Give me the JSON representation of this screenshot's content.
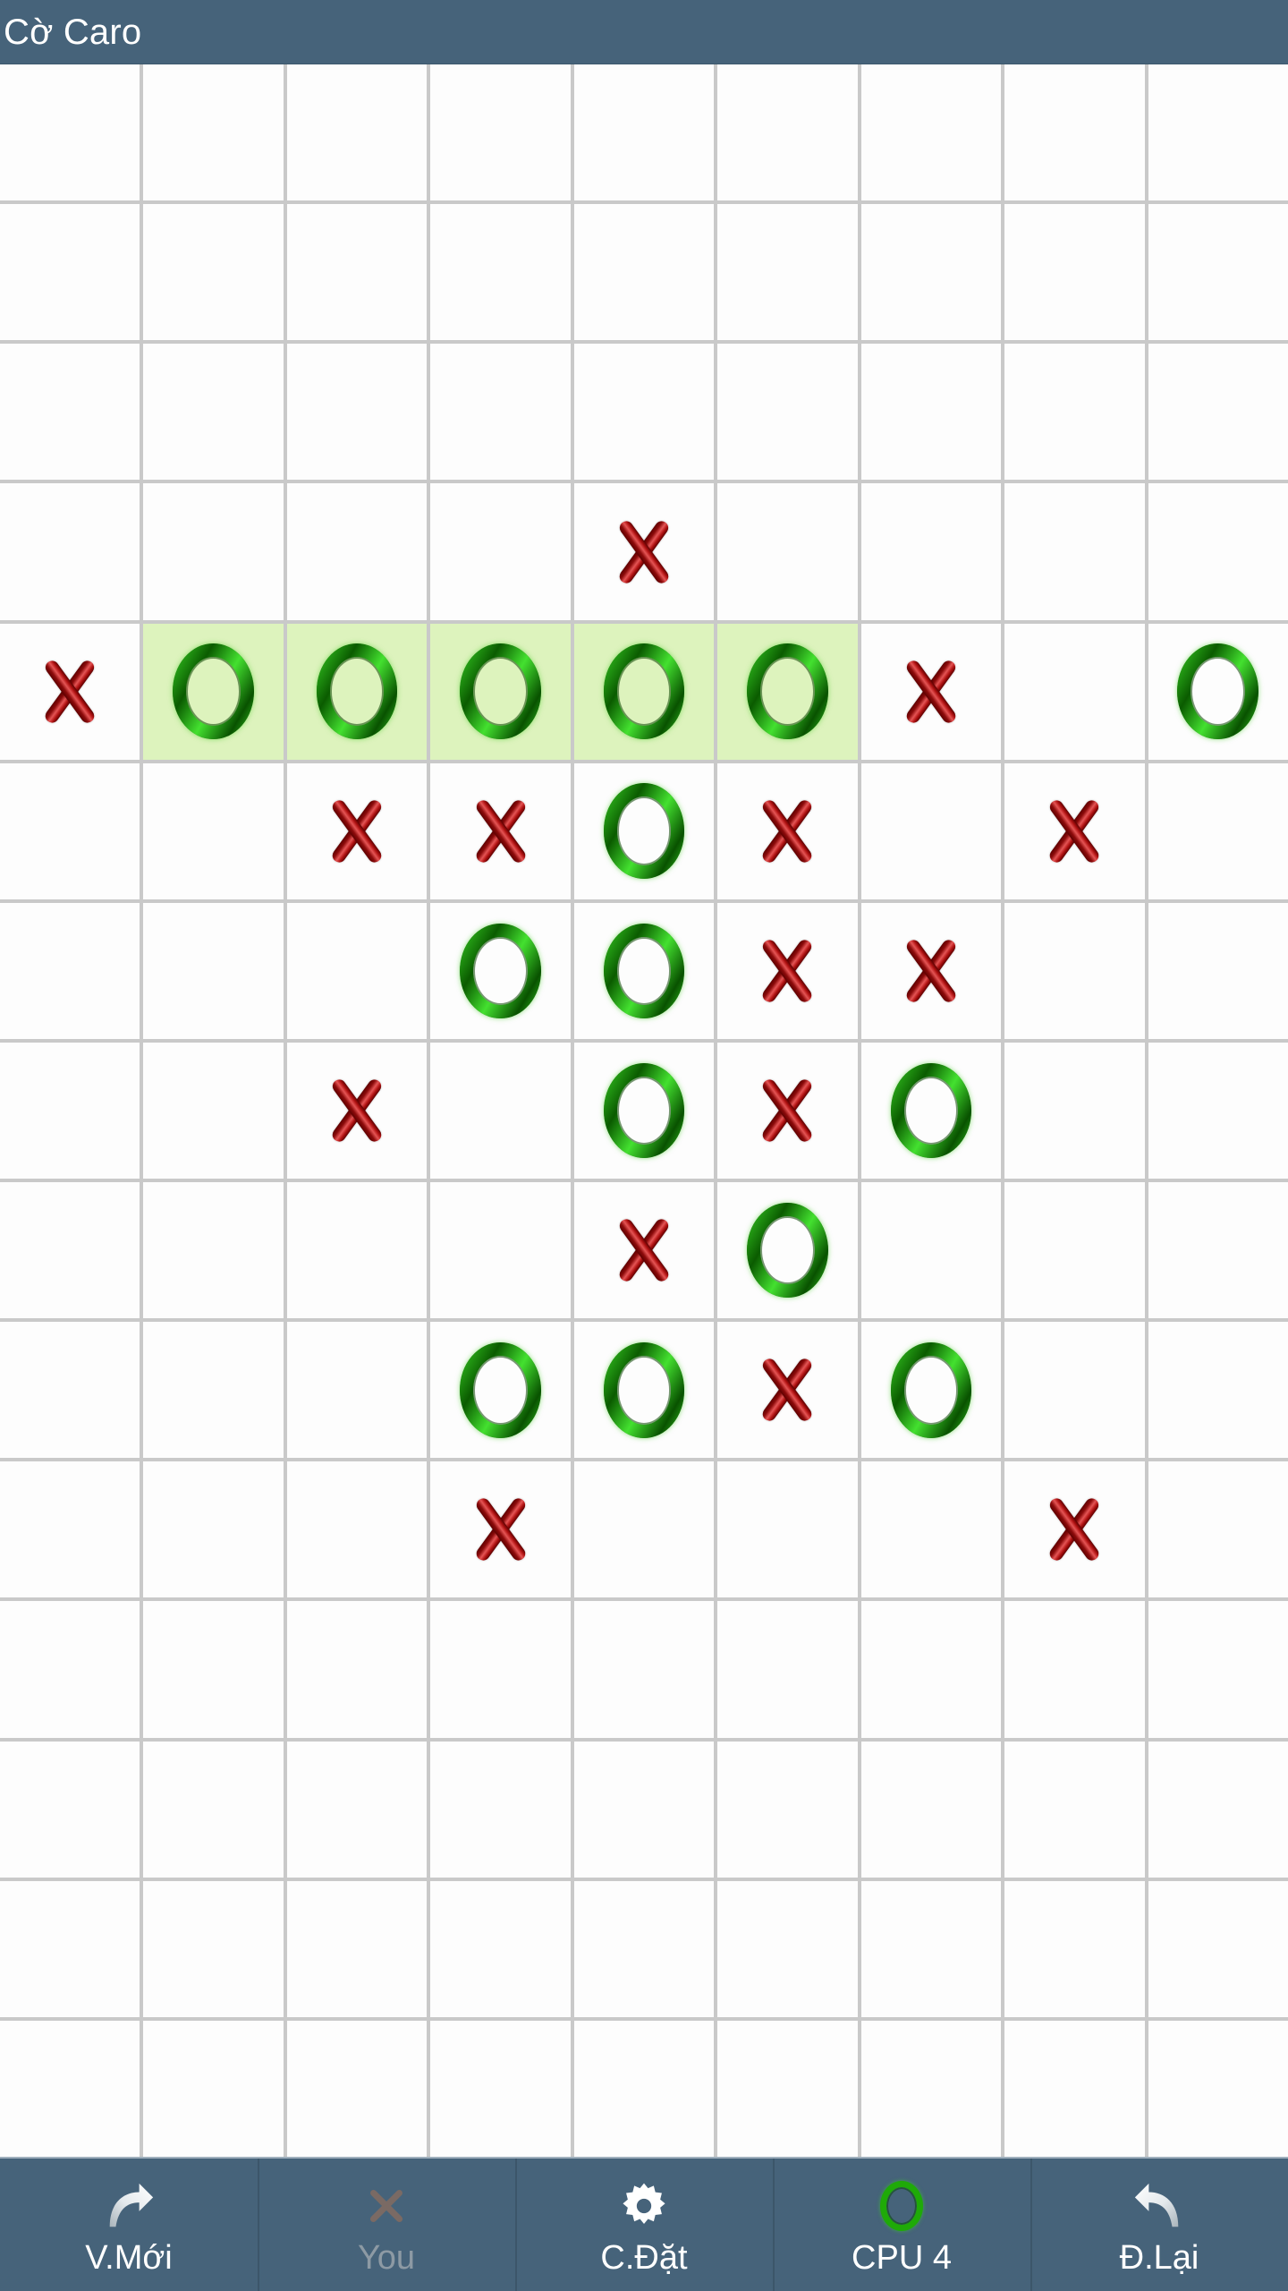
{
  "header": {
    "title": "Cờ Caro",
    "bg_color": "#46637a",
    "text_color": "#ffffff"
  },
  "board": {
    "columns": 9,
    "rows": 15,
    "grid_line_color": "#c9c9c9",
    "cell_color": "#fdfdfd",
    "highlight_color": "#ddf3bd",
    "x_color": "#8d0b0b",
    "o_color": "#1f7a0a",
    "legend": {
      "x": "X",
      "o": "O",
      "empty": ""
    },
    "cells": [
      [
        "",
        "",
        "",
        "",
        "",
        "",
        "",
        "",
        ""
      ],
      [
        "",
        "",
        "",
        "",
        "",
        "",
        "",
        "",
        ""
      ],
      [
        "",
        "",
        "",
        "",
        "",
        "",
        "",
        "",
        ""
      ],
      [
        "",
        "",
        "",
        "",
        "X",
        "",
        "",
        "",
        ""
      ],
      [
        "X",
        "O",
        "O",
        "O",
        "O",
        "O",
        "X",
        "",
        "O"
      ],
      [
        "",
        "",
        "X",
        "X",
        "O",
        "X",
        "",
        "X",
        ""
      ],
      [
        "",
        "",
        "",
        "O",
        "O",
        "X",
        "X",
        "",
        ""
      ],
      [
        "",
        "",
        "X",
        "",
        "O",
        "X",
        "O",
        "",
        ""
      ],
      [
        "",
        "",
        "",
        "",
        "X",
        "O",
        "",
        "",
        ""
      ],
      [
        "",
        "",
        "",
        "O",
        "O",
        "X",
        "O",
        "",
        ""
      ],
      [
        "",
        "",
        "",
        "X",
        "",
        "",
        "",
        "X",
        ""
      ],
      [
        "",
        "",
        "",
        "",
        "",
        "",
        "",
        "",
        ""
      ],
      [
        "",
        "",
        "",
        "",
        "",
        "",
        "",
        "",
        ""
      ],
      [
        "",
        "",
        "",
        "",
        "",
        "",
        "",
        "",
        ""
      ],
      [
        "",
        "",
        "",
        "",
        "",
        "",
        "",
        "",
        ""
      ]
    ],
    "highlighted": [
      [
        4,
        1
      ],
      [
        4,
        2
      ],
      [
        4,
        3
      ],
      [
        4,
        4
      ],
      [
        4,
        5
      ]
    ]
  },
  "toolbar": {
    "bg_color": "#46637a",
    "items": [
      {
        "label": "V.Mới",
        "icon": "redo-arrow-icon",
        "disabled": false
      },
      {
        "label": "You",
        "icon": "x-mark-icon",
        "disabled": true
      },
      {
        "label": "C.Đặt",
        "icon": "gear-icon",
        "disabled": false
      },
      {
        "label": "CPU 4",
        "icon": "o-mark-icon",
        "disabled": false
      },
      {
        "label": "Đ.Lại",
        "icon": "undo-arrow-icon",
        "disabled": false
      }
    ]
  }
}
